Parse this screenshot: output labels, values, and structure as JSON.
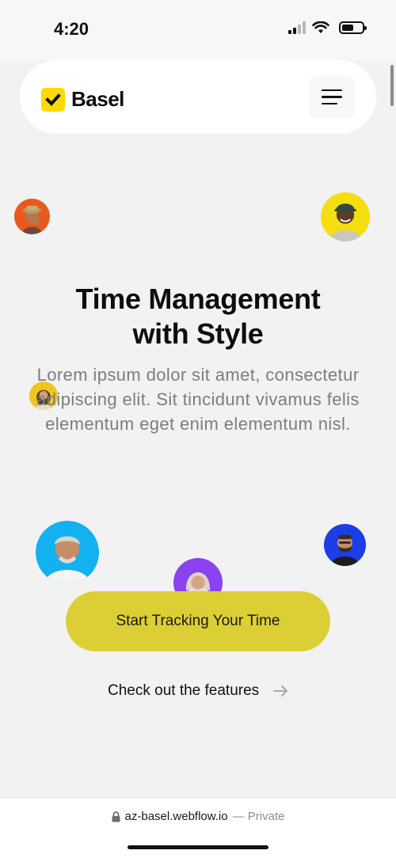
{
  "status_bar": {
    "time": "4:20",
    "icons": [
      "signal-icon",
      "wifi-icon",
      "battery-icon"
    ]
  },
  "nav": {
    "logo_text": "Basel",
    "logo_icon": "checkmark-icon",
    "menu_icon": "hamburger-menu-icon",
    "brand_color": "#ffd900"
  },
  "hero": {
    "title_line1": "Time Management",
    "title_line2": "with Style",
    "description": "Lorem ipsum dolor sit amet, consectetur adipiscing elit. Sit tincidunt vivamus felis elementum eget enim elementum nisl.",
    "cta_label": "Start Tracking Your Time",
    "cta_color": "#dccf35",
    "link_label": "Check out the features",
    "link_icon": "arrow-right-icon"
  },
  "avatars": [
    {
      "name": "avatar-orange",
      "bg": "#e85a1c"
    },
    {
      "name": "avatar-yellow",
      "bg": "#f4de10"
    },
    {
      "name": "avatar-small-yellow",
      "bg": "#f0c520"
    },
    {
      "name": "avatar-blue",
      "bg": "#14b1f0"
    },
    {
      "name": "avatar-purple",
      "bg": "#8a43ef"
    },
    {
      "name": "avatar-navy",
      "bg": "#1b3ee6"
    }
  ],
  "browser": {
    "url": "az-basel.webflow.io",
    "privacy": "— Private",
    "lock_icon": "lock-icon"
  }
}
